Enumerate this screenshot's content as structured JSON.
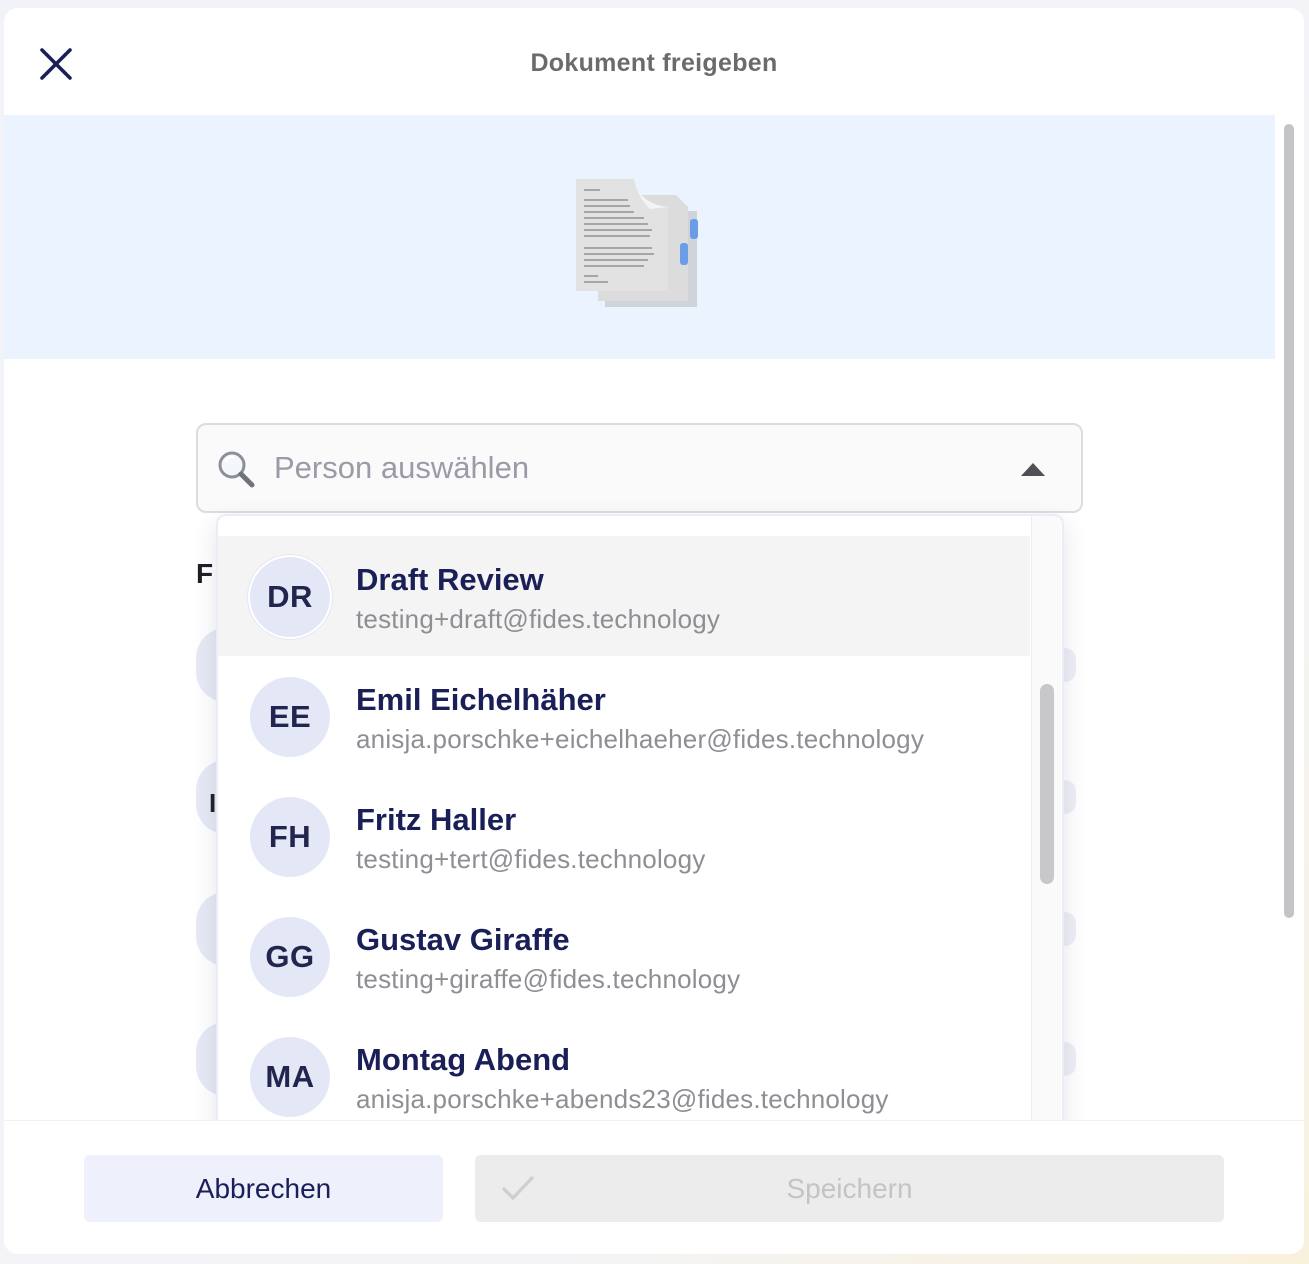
{
  "dialog": {
    "title": "Dokument freigeben"
  },
  "search": {
    "placeholder": "Person auswählen",
    "value": ""
  },
  "background": {
    "section_label_initial": "F",
    "row_initial": "I"
  },
  "dropdown": {
    "options": [
      {
        "initials": "DR",
        "name": "Draft Review",
        "email": "testing+draft@fides.technology",
        "highlighted": true
      },
      {
        "initials": "EE",
        "name": "Emil Eichelhäher",
        "email": "anisja.porschke+eichelhaeher@fides.technology"
      },
      {
        "initials": "FH",
        "name": "Fritz Haller",
        "email": "testing+tert@fides.technology"
      },
      {
        "initials": "GG",
        "name": "Gustav Giraffe",
        "email": "testing+giraffe@fides.technology"
      },
      {
        "initials": "MA",
        "name": "Montag Abend",
        "email": "anisja.porschke+abends23@fides.technology"
      }
    ]
  },
  "footer": {
    "cancel_label": "Abbrechen",
    "save_label": "Speichern"
  },
  "icons": {
    "close": "close-icon",
    "search": "search-icon",
    "caret": "caret-up-icon",
    "check": "check-icon",
    "document": "document-icon"
  },
  "colors": {
    "primary_text": "#1a1f58",
    "hero_bg": "#ebf3fe",
    "avatar_bg": "#e4e7f5",
    "cancel_bg": "#eef0fb",
    "disabled_bg": "#ececec"
  }
}
